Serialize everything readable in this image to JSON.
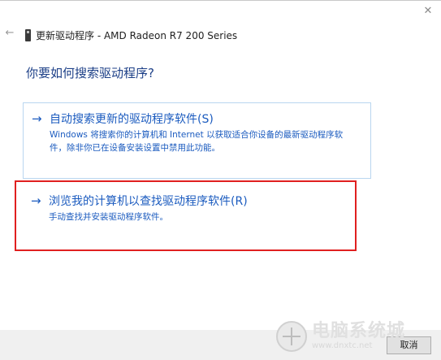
{
  "window": {
    "title": "更新驱动程序 - AMD Radeon R7 200 Series",
    "close_glyph": "✕",
    "back_glyph": "←"
  },
  "heading": "你要如何搜索驱动程序?",
  "options": [
    {
      "arrow": "→",
      "title": "自动搜索更新的驱动程序软件(S)",
      "description": "Windows 将搜索你的计算机和 Internet 以获取适合你设备的最新驱动程序软件，除非你已在设备安装设置中禁用此功能。"
    },
    {
      "arrow": "→",
      "title": "浏览我的计算机以查找驱动程序软件(R)",
      "description": "手动查找并安装驱动程序软件。"
    }
  ],
  "footer": {
    "cancel_label": "取消"
  },
  "watermark": {
    "text": "电脑系统城",
    "url": "www.dnxtc.net"
  },
  "colors": {
    "link_blue": "#1b5bbf",
    "heading_blue": "#1c3f87",
    "highlight_red": "#e02020",
    "option_border": "#b9d6f0"
  }
}
